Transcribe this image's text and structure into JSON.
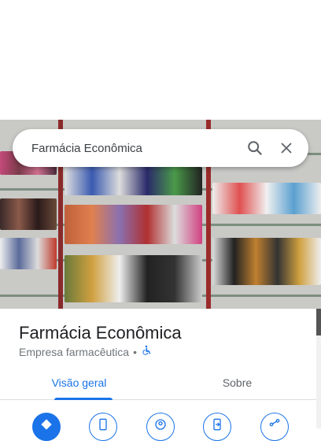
{
  "search": {
    "query": "Farmácia Econômica",
    "search_icon": "search-icon",
    "close_icon": "close-icon"
  },
  "place": {
    "name": "Farmácia Econômica",
    "category": "Empresa farmacêutica",
    "separator": "•",
    "accessibility_icon": "wheelchair-icon"
  },
  "tabs": [
    {
      "label": "Visão geral",
      "active": true
    },
    {
      "label": "Sobre",
      "active": false
    }
  ],
  "actions": [
    {
      "icon": "directions-icon"
    },
    {
      "icon": "phone-icon"
    },
    {
      "icon": "nearby-icon"
    },
    {
      "icon": "send-to-phone-icon"
    },
    {
      "icon": "share-icon"
    }
  ],
  "colors": {
    "accent": "#1a73e8"
  }
}
